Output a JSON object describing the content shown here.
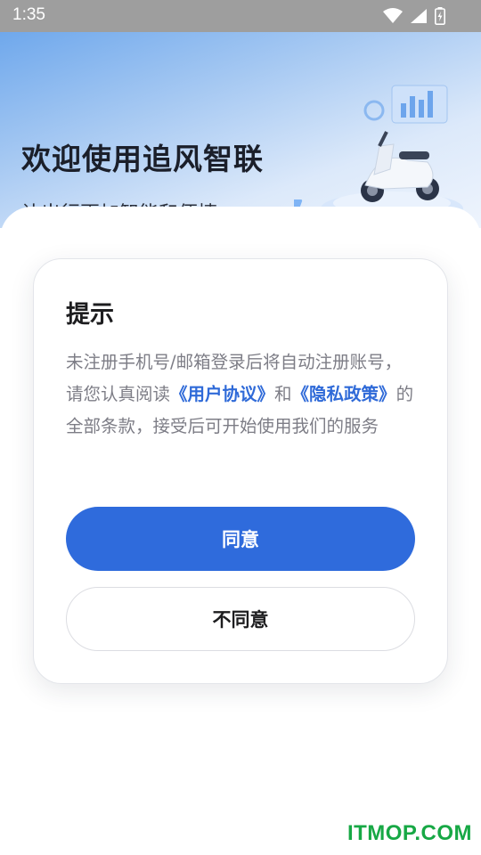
{
  "status_bar": {
    "time": "1:35"
  },
  "hero": {
    "title": "欢迎使用追风智联",
    "subtitle": "让出行更加智能和便捷"
  },
  "dialog": {
    "title": "提示",
    "message_part1": "未注册手机号/邮箱登录后将自动注册账号，请您认真阅读",
    "link_user_agreement": "《用户协议》",
    "message_part2": "和",
    "link_privacy_policy": "《隐私政策》",
    "message_part3": "的全部条款，接受后可开始使用我们的服务",
    "agree_label": "同意",
    "disagree_label": "不同意"
  },
  "watermark": "ITMOP.COM",
  "colors": {
    "accent": "#2f6bdc",
    "link": "#2f6ad8",
    "watermark": "#17a845"
  }
}
